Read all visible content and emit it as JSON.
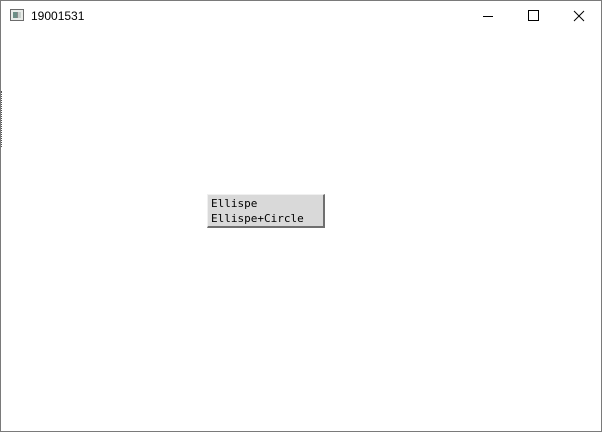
{
  "window": {
    "title": "19001531"
  },
  "titlebar": {
    "minimize_icon": "minimize-icon",
    "maximize_icon": "maximize-icon",
    "close_icon": "close-icon"
  },
  "menu": {
    "items": [
      {
        "label": "Ellispe"
      },
      {
        "label": "Ellispe+Circle"
      }
    ]
  }
}
